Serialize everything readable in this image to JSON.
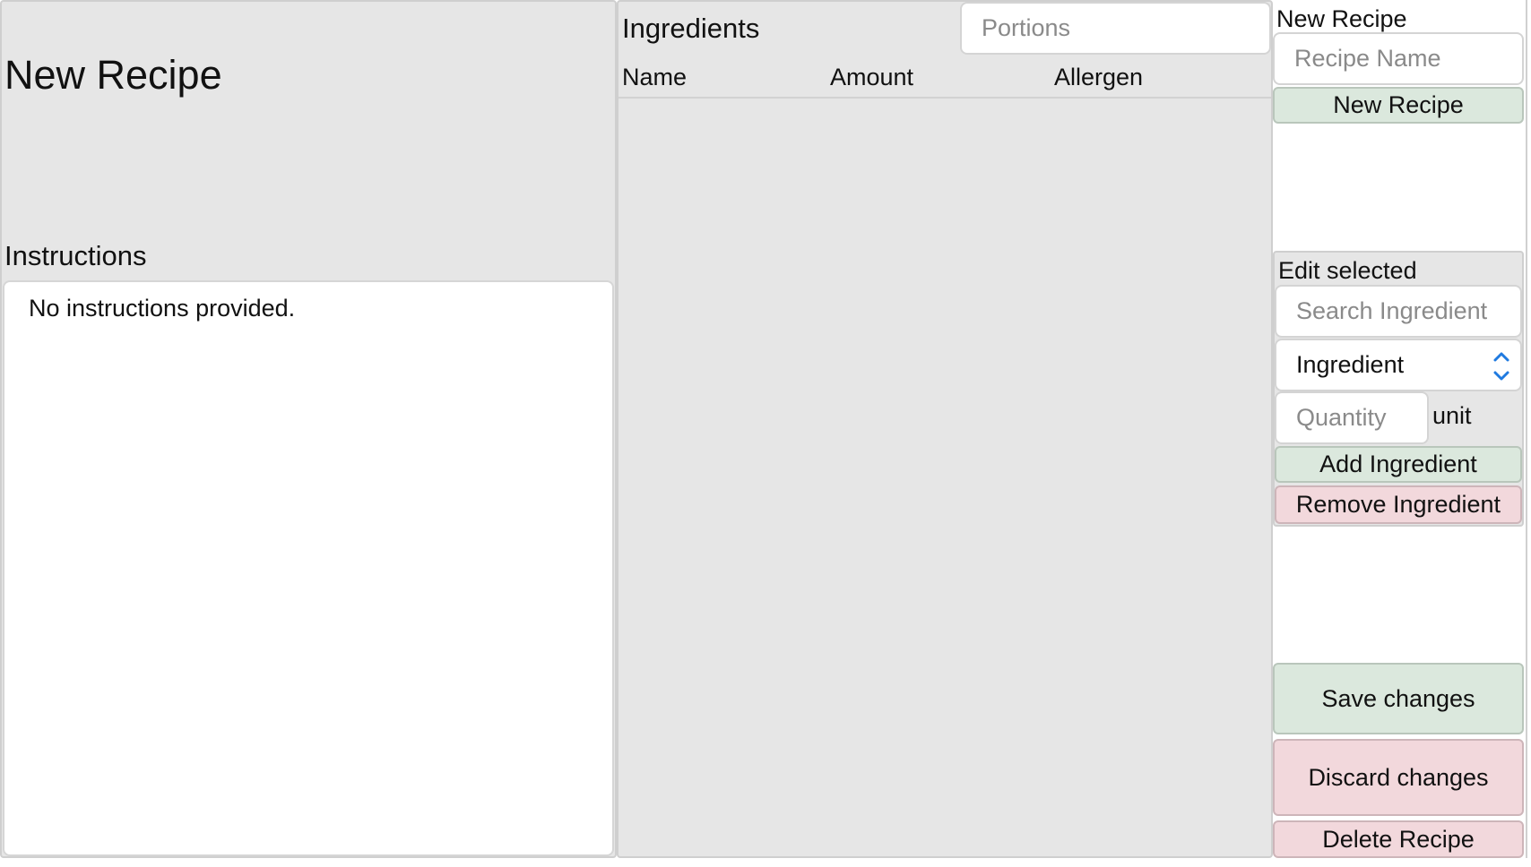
{
  "recipe": {
    "title": "New Recipe",
    "instructions_heading": "Instructions",
    "instructions_text": "No instructions provided."
  },
  "ingredients": {
    "heading": "Ingredients",
    "portions_placeholder": "Portions",
    "columns": [
      "Name",
      "Amount",
      "Allergen"
    ],
    "rows": []
  },
  "new_recipe_form": {
    "heading": "New Recipe",
    "name_placeholder": "Recipe Name",
    "button_label": "New Recipe"
  },
  "edit_form": {
    "heading": "Edit selected",
    "search_placeholder": "Search Ingredient",
    "ingredient_select_value": "Ingredient",
    "quantity_placeholder": "Quantity",
    "unit_label": "unit",
    "add_label": "Add Ingredient",
    "remove_label": "Remove Ingredient"
  },
  "actions": {
    "save_label": "Save changes",
    "discard_label": "Discard changes",
    "delete_label": "Delete Recipe"
  },
  "colors": {
    "panel_bg": "#e6e6e6",
    "green_button": "#dbe8dd",
    "red_button": "#f2d8dc",
    "stepper_blue": "#1f7ae0"
  },
  "icons": {
    "select_stepper": "chevron-up-down-icon"
  }
}
